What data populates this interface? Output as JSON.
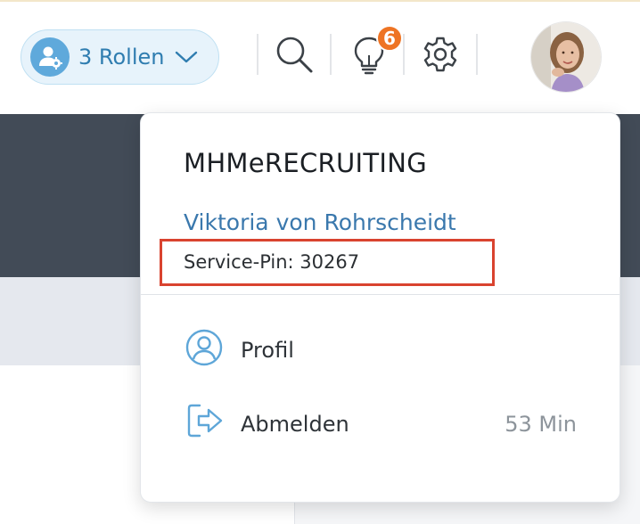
{
  "topbar": {
    "roles_label": "3 Rollen",
    "notifications_count": "6"
  },
  "dropdown": {
    "org_name": "MHMeRECRUITING",
    "user_name": "Viktoria von Rohrscheidt",
    "service_pin": "Service-Pin: 30267",
    "menu": [
      {
        "label": "Profil",
        "icon": "user-circle-icon"
      },
      {
        "label": "Abmelden",
        "icon": "logout-icon",
        "meta": "53 Min"
      }
    ]
  },
  "colors": {
    "accent": "#2f7db0",
    "badge": "#ee7424",
    "highlight_border": "#d9432f",
    "dark_band": "#424b57"
  }
}
